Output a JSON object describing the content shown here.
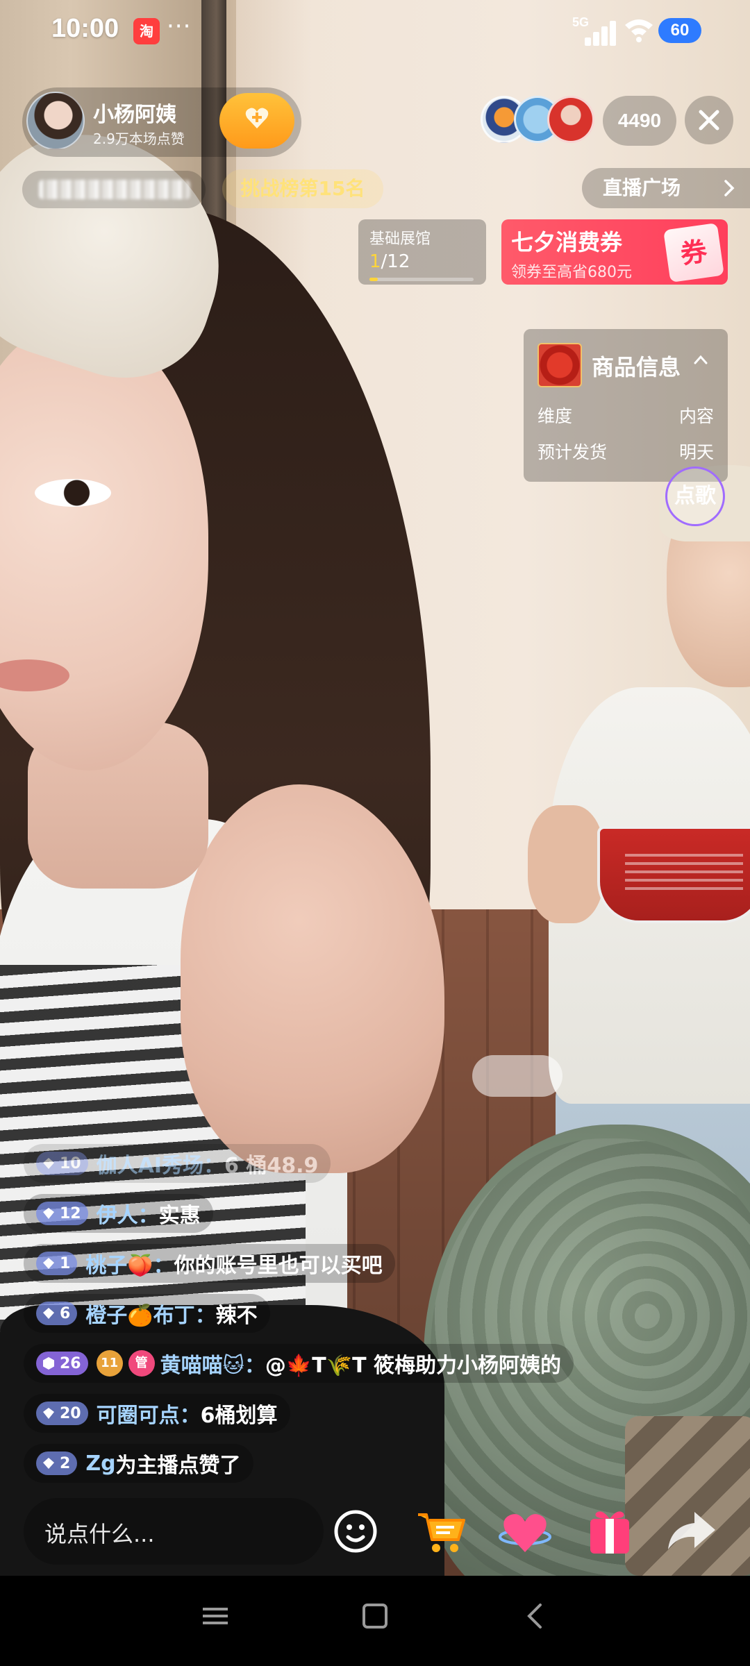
{
  "status_bar": {
    "time": "10:00",
    "app_badge": "淘",
    "more": "···",
    "network": "5G",
    "battery": "60"
  },
  "host": {
    "name": "小杨阿姨",
    "likes": "2.9万本场点赞",
    "follow_icon": "heart-plus-icon"
  },
  "viewers": {
    "count": "4490",
    "close_icon": "close-icon"
  },
  "ranking": {
    "label": "挑战榜第15名"
  },
  "plaza": {
    "label": "直播广场"
  },
  "mission": {
    "title": "基础展馆",
    "current": "1",
    "total": "/12",
    "progress_fraction": 0.083
  },
  "coupon": {
    "title": "七夕消费券",
    "subtitle": "领券至高省680元",
    "icon_text": "券"
  },
  "product_info": {
    "title": "商品信息",
    "rows": [
      {
        "label": "维度",
        "value": "内容"
      },
      {
        "label": "预计发货",
        "value": "明天"
      }
    ]
  },
  "song_button": {
    "label": "点歌"
  },
  "comments": [
    {
      "level": "10",
      "user": "伽人AI秀场",
      "sep": "：",
      "text": "6 桶48.9",
      "faded": true
    },
    {
      "level": "12",
      "user": "伊人",
      "sep": "：",
      "text": "实惠"
    },
    {
      "level": "1",
      "user": "桃子🍑",
      "sep": "：",
      "text": "你的账号里也可以买吧"
    },
    {
      "level": "6",
      "user": "橙子🍊布丁",
      "sep": "：",
      "text": "辣不"
    },
    {
      "level": "26",
      "badge1": "11",
      "badge2": "管",
      "user": "黄喵喵🐱",
      "sep": "：",
      "text": "@🍁T🌾T 筱梅助力小杨阿姨的"
    },
    {
      "level": "20",
      "user": "可圈可点",
      "sep": "：",
      "text": "6桶划算"
    },
    {
      "level": "2",
      "user": "Zg",
      "sep": " ",
      "text": "为主播点赞了"
    }
  ],
  "bottom_bar": {
    "input_placeholder": "说点什么...",
    "icons": [
      "emoji-icon",
      "cart-icon",
      "heart-gift-icon",
      "gift-box-icon",
      "share-icon"
    ]
  },
  "nav_bar": {
    "icons": [
      "menu-icon",
      "home-icon",
      "back-icon"
    ]
  },
  "colors": {
    "accent_gold": "#ffd53a",
    "coupon_red": "#ff3f5c",
    "username_blue": "#a6d4ff"
  }
}
